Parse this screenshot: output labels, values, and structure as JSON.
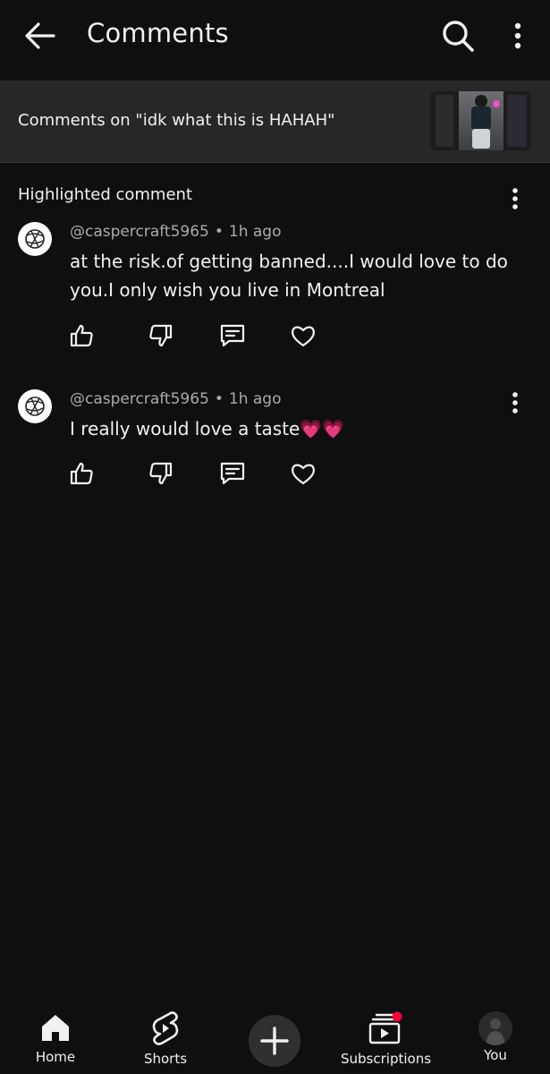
{
  "header": {
    "title": "Comments",
    "back_icon": "arrow-left-icon",
    "search_icon": "search-icon",
    "more_icon": "more-vert-icon"
  },
  "video": {
    "label": "Comments on \"idk what this is HAHAH\""
  },
  "highlighted": {
    "label": "Highlighted comment"
  },
  "comments": [
    {
      "author": "@caspercraft5965",
      "separator": "•",
      "time": "1h ago",
      "text": "at the risk.of getting banned....I would love to do you.I only wish you live in Montreal"
    },
    {
      "author": "@caspercraft5965",
      "separator": "•",
      "time": "1h ago",
      "text": "I really would love a taste💗💗"
    }
  ],
  "nav": {
    "home": "Home",
    "shorts": "Shorts",
    "subscriptions": "Subscriptions",
    "you": "You"
  },
  "colors": {
    "background": "#0f0f0f",
    "surface": "#272727",
    "text": "#f1f1f1",
    "secondary_text": "#aaaaaa",
    "notification_dot": "#ff0033"
  }
}
